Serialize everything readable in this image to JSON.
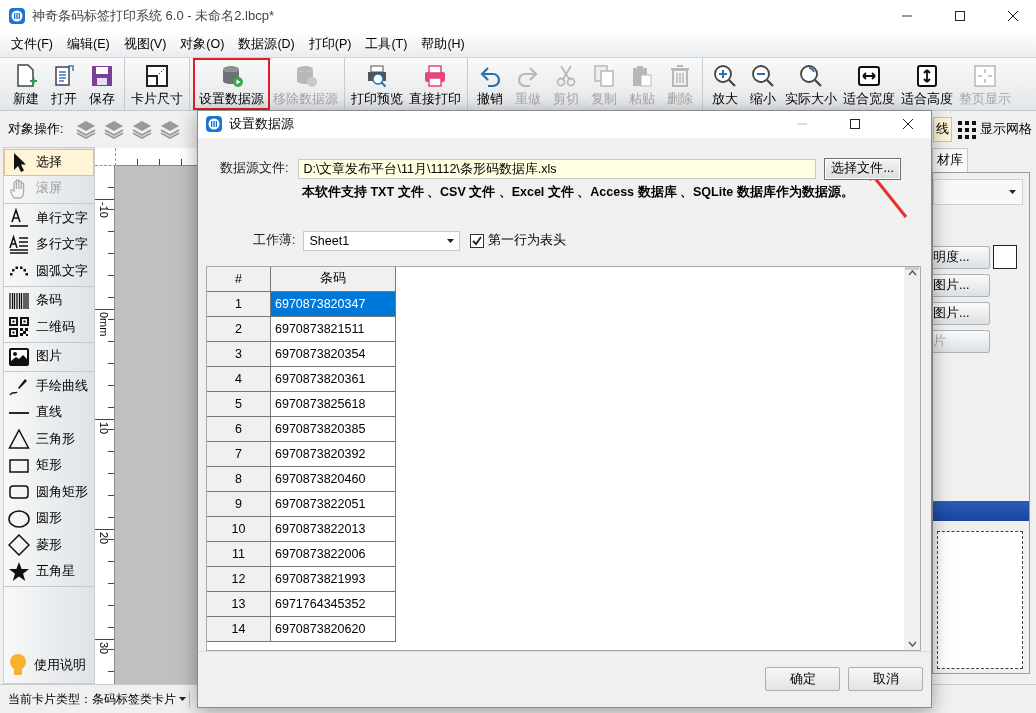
{
  "window": {
    "title": "神奇条码标签打印系统 6.0 - 未命名2.lbcp*"
  },
  "menu": [
    "文件(F)",
    "编辑(E)",
    "视图(V)",
    "对象(O)",
    "数据源(D)",
    "打印(P)",
    "工具(T)",
    "帮助(H)"
  ],
  "toolbar": [
    [
      {
        "label": "新建",
        "disabled": false,
        "highlighted": false
      },
      {
        "label": "打开",
        "disabled": false,
        "highlighted": false
      },
      {
        "label": "保存",
        "disabled": false,
        "highlighted": false
      }
    ],
    [
      {
        "label": "卡片尺寸",
        "disabled": false,
        "highlighted": false
      }
    ],
    [
      {
        "label": "设置数据源",
        "disabled": false,
        "highlighted": true
      },
      {
        "label": "移除数据源",
        "disabled": true,
        "highlighted": false
      }
    ],
    [
      {
        "label": "打印预览",
        "disabled": false,
        "highlighted": false
      },
      {
        "label": "直接打印",
        "disabled": false,
        "highlighted": false
      }
    ],
    [
      {
        "label": "撤销",
        "disabled": false,
        "highlighted": false
      },
      {
        "label": "重做",
        "disabled": true,
        "highlighted": false
      },
      {
        "label": "剪切",
        "disabled": true,
        "highlighted": false
      },
      {
        "label": "复制",
        "disabled": true,
        "highlighted": false
      },
      {
        "label": "粘贴",
        "disabled": true,
        "highlighted": false
      },
      {
        "label": "删除",
        "disabled": true,
        "highlighted": false
      }
    ],
    [
      {
        "label": "放大",
        "disabled": false,
        "highlighted": false
      },
      {
        "label": "缩小",
        "disabled": false,
        "highlighted": false
      },
      {
        "label": "实际大小",
        "disabled": false,
        "highlighted": false
      },
      {
        "label": "适合宽度",
        "disabled": false,
        "highlighted": false
      },
      {
        "label": "适合高度",
        "disabled": false,
        "highlighted": false
      },
      {
        "label": "整页显示",
        "disabled": true,
        "highlighted": false
      }
    ]
  ],
  "object_bar": {
    "label": "对象操作:"
  },
  "tools": [
    [
      {
        "label": "选择",
        "selected": true,
        "disabled": false
      },
      {
        "label": "滚屏",
        "selected": false,
        "disabled": true
      }
    ],
    [
      {
        "label": "单行文字",
        "selected": false,
        "disabled": false
      },
      {
        "label": "多行文字",
        "selected": false,
        "disabled": false
      },
      {
        "label": "圆弧文字",
        "selected": false,
        "disabled": false
      }
    ],
    [
      {
        "label": "条码",
        "selected": false,
        "disabled": false
      },
      {
        "label": "二维码",
        "selected": false,
        "disabled": false
      }
    ],
    [
      {
        "label": "图片",
        "selected": false,
        "disabled": false
      }
    ],
    [
      {
        "label": "手绘曲线",
        "selected": false,
        "disabled": false
      },
      {
        "label": "直线",
        "selected": false,
        "disabled": false
      },
      {
        "label": "三角形",
        "selected": false,
        "disabled": false
      },
      {
        "label": "矩形",
        "selected": false,
        "disabled": false
      },
      {
        "label": "圆角矩形",
        "selected": false,
        "disabled": false
      },
      {
        "label": "圆形",
        "selected": false,
        "disabled": false
      },
      {
        "label": "菱形",
        "selected": false,
        "disabled": false
      },
      {
        "label": "五角星",
        "selected": false,
        "disabled": false
      }
    ]
  ],
  "help": "使用说明",
  "ruler_labels": [
    "-10",
    "0mm",
    "10",
    "20",
    "30"
  ],
  "right_panel": {
    "line_toggle": "线",
    "grid_toggle": "显示网格",
    "tab": "材库",
    "buttons": [
      {
        "label": "明度...",
        "disabled": false
      },
      {
        "label": "图片...",
        "disabled": false
      },
      {
        "label": "图片...",
        "disabled": false
      },
      {
        "label": "片",
        "disabled": true
      }
    ]
  },
  "status_bar": {
    "card_type": "当前卡片类型：条码标签类卡片"
  },
  "dialog": {
    "title": "设置数据源",
    "file_label": "数据源文件:",
    "file_path": "D:\\文章发布平台\\11月\\1112\\条形码数据库.xls",
    "choose_button": "选择文件...",
    "note": "本软件支持 TXT 文件 、CSV 文件 、Excel 文件 、Access 数据库 、SQLite 数据库作为数据源。",
    "sheet_label": "工作薄:",
    "sheet": "Sheet1",
    "header_row": {
      "label": "第一行为表头",
      "checked": true
    },
    "table": {
      "columns": [
        "#",
        "条码"
      ],
      "rows": [
        {
          "index": "1",
          "code": "6970873820347",
          "selected": true
        },
        {
          "index": "2",
          "code": "6970873821511",
          "selected": false
        },
        {
          "index": "3",
          "code": "6970873820354",
          "selected": false
        },
        {
          "index": "4",
          "code": "6970873820361",
          "selected": false
        },
        {
          "index": "5",
          "code": "6970873825618",
          "selected": false
        },
        {
          "index": "6",
          "code": "6970873820385",
          "selected": false
        },
        {
          "index": "7",
          "code": "6970873820392",
          "selected": false
        },
        {
          "index": "8",
          "code": "6970873820460",
          "selected": false
        },
        {
          "index": "9",
          "code": "6970873822051",
          "selected": false
        },
        {
          "index": "10",
          "code": "6970873822013",
          "selected": false
        },
        {
          "index": "11",
          "code": "6970873822006",
          "selected": false
        },
        {
          "index": "12",
          "code": "6970873821993",
          "selected": false
        },
        {
          "index": "13",
          "code": "6971764345352",
          "selected": false
        },
        {
          "index": "14",
          "code": "6970873820620",
          "selected": false
        }
      ]
    },
    "buttons": [
      "确定",
      "取消"
    ]
  }
}
